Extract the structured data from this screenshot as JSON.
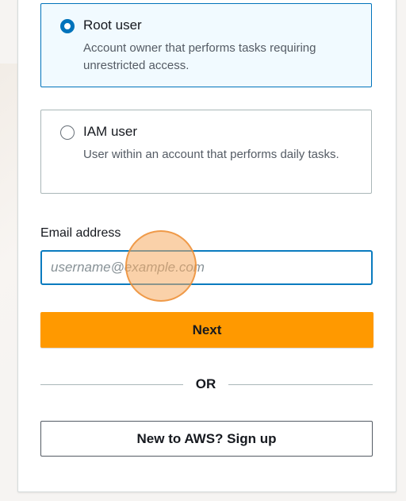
{
  "sign_in_type": {
    "options": [
      {
        "title": "Root user",
        "description": "Account owner that performs tasks requiring unrestricted access.",
        "selected": true
      },
      {
        "title": "IAM user",
        "description": "User within an account that performs daily tasks.",
        "selected": false
      }
    ]
  },
  "email": {
    "label": "Email address",
    "placeholder": "username@example.com",
    "value": ""
  },
  "actions": {
    "next_label": "Next",
    "divider_text": "OR",
    "signup_label": "New to AWS? Sign up"
  },
  "colors": {
    "primary_button": "#ff9900",
    "selected_border": "#0073bb",
    "selected_background": "#f1faff",
    "input_focus_border": "#0a7bbf",
    "cursor_highlight": "#f6ac62"
  }
}
